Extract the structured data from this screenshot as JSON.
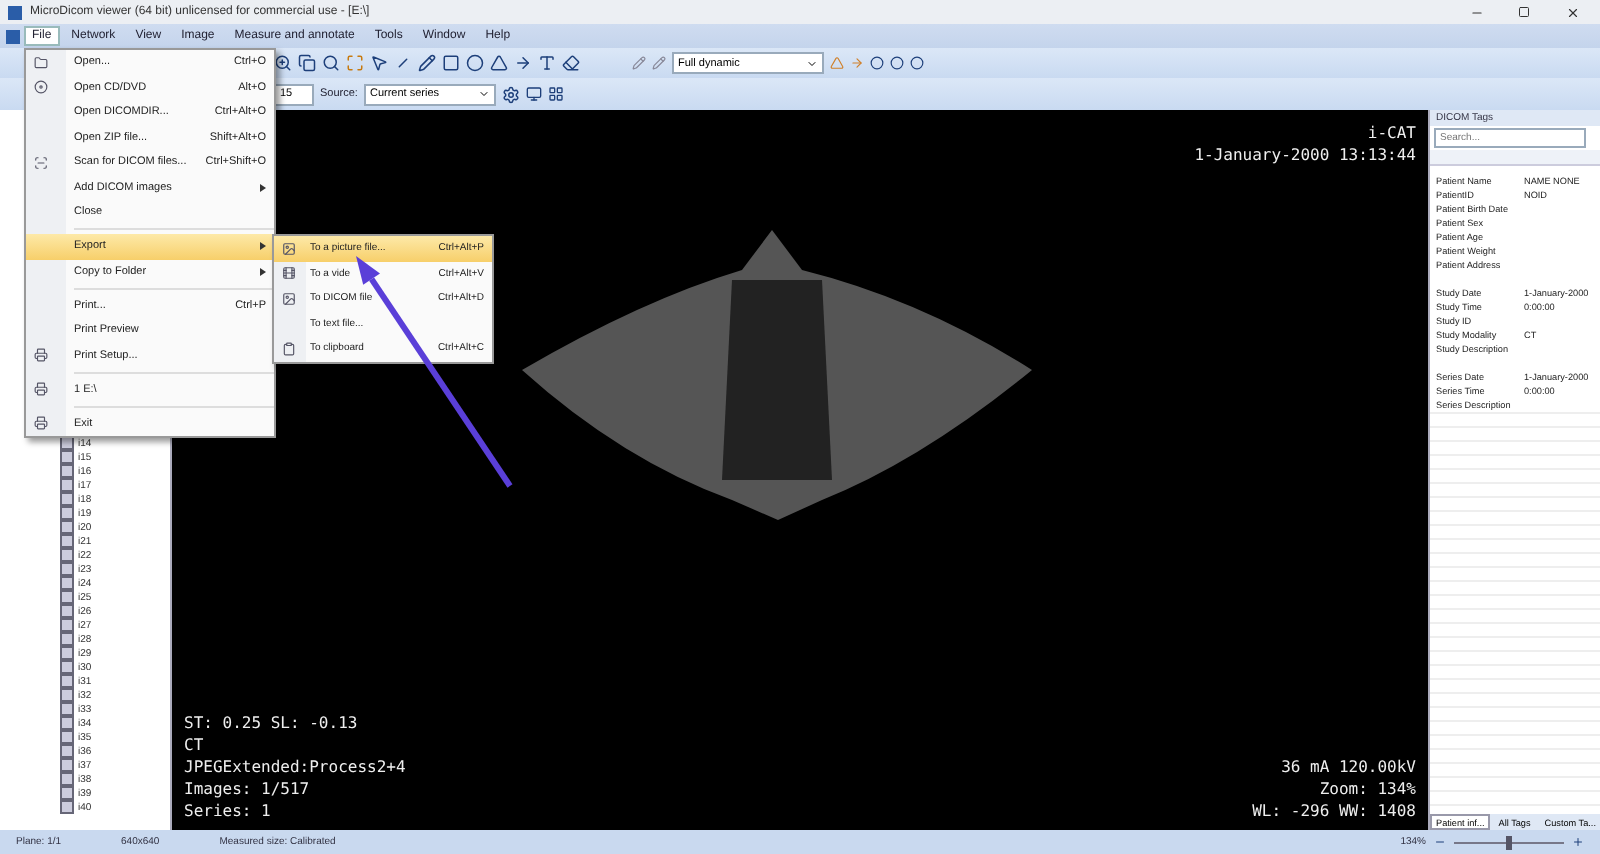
{
  "window": {
    "title": "MicroDicom viewer (64 bit) unlicensed for commercial use - [E:\\]"
  },
  "menu_bar": [
    {
      "label": "File",
      "selected": true
    },
    {
      "label": "Network",
      "selected": false
    },
    {
      "label": "View",
      "selected": false
    },
    {
      "label": "Image",
      "selected": false
    },
    {
      "label": "Measure and annotate",
      "selected": false
    },
    {
      "label": "Tools",
      "selected": false
    },
    {
      "label": "Window",
      "selected": false
    },
    {
      "label": "Help",
      "selected": false
    }
  ],
  "toolbar": {
    "display_mode": "Full dynamic",
    "frame_field": "15",
    "source_label": "Source:",
    "source": "Current series"
  },
  "file_menu": [
    {
      "kind": "item",
      "label": "Open...",
      "shortcut": "Ctrl+O",
      "selected": false
    },
    {
      "kind": "item",
      "label": "Open CD/DVD",
      "shortcut": "Alt+O",
      "selected": false
    },
    {
      "kind": "item",
      "label": "Open DICOMDIR...",
      "shortcut": "Ctrl+Alt+O",
      "selected": false
    },
    {
      "kind": "item",
      "label": "Open ZIP file...",
      "shortcut": "Shift+Alt+O",
      "selected": false
    },
    {
      "kind": "item",
      "label": "Scan for DICOM files...",
      "shortcut": "Ctrl+Shift+O",
      "selected": false
    },
    {
      "kind": "submenu",
      "label": "Add DICOM images",
      "selected": false
    },
    {
      "kind": "item",
      "label": "Close",
      "selected": false
    },
    {
      "kind": "separator"
    },
    {
      "kind": "submenu",
      "label": "Export",
      "selected": true
    },
    {
      "kind": "submenu",
      "label": "Copy to Folder",
      "selected": false
    },
    {
      "kind": "separator"
    },
    {
      "kind": "item",
      "label": "Print...",
      "shortcut": "Ctrl+P",
      "selected": false
    },
    {
      "kind": "item",
      "label": "Print Preview",
      "selected": false
    },
    {
      "kind": "item",
      "label": "Print Setup...",
      "selected": false
    },
    {
      "kind": "separator"
    },
    {
      "kind": "item",
      "label": "1 E:\\",
      "selected": false
    },
    {
      "kind": "separator"
    },
    {
      "kind": "item",
      "label": "Exit",
      "selected": false
    }
  ],
  "export_submenu": [
    {
      "label": "To a picture file...",
      "shortcut": "Ctrl+Alt+P",
      "selected": true
    },
    {
      "label": "To a vide",
      "shortcut": "Ctrl+Alt+V",
      "selected": false
    },
    {
      "label": "To DICOM file",
      "shortcut": "Ctrl+Alt+D",
      "selected": false
    },
    {
      "label": "To text file...",
      "selected": false
    },
    {
      "label": "To clipboard",
      "shortcut": "Ctrl+Alt+C",
      "selected": false
    }
  ],
  "image_tree": [
    "i14",
    "i15",
    "i16",
    "i17",
    "i18",
    "i19",
    "i20",
    "i21",
    "i22",
    "i23",
    "i24",
    "i25",
    "i26",
    "i27",
    "i28",
    "i29",
    "i30",
    "i31",
    "i32",
    "i33",
    "i34",
    "i35",
    "i36",
    "i37",
    "i38",
    "i39",
    "i40"
  ],
  "viewer": {
    "top_right": [
      "i-CAT",
      "1-January-2000 13:13:44"
    ],
    "bottom_left": [
      "ST: 0.25 SL: -0.13",
      "CT",
      "JPEGExtended:Process2+4",
      "Images: 1/517",
      "Series: 1"
    ],
    "bottom_right": [
      "36 mA 120.00kV",
      "Zoom: 134%",
      "WL: -296 WW: 1408"
    ]
  },
  "dicom_tags": {
    "title": "DICOM Tags",
    "search": {
      "placeholder": "Search..."
    },
    "groups": [
      [
        {
          "name": "Patient Name",
          "value": "NAME NONE"
        },
        {
          "name": "PatientID",
          "value": "NOID"
        },
        {
          "name": "Patient Birth Date"
        },
        {
          "name": "Patient Sex"
        },
        {
          "name": "Patient Age"
        },
        {
          "name": "Patient Weight"
        },
        {
          "name": "Patient Address"
        }
      ],
      [
        {
          "name": "Study Date",
          "value": "1-January-2000"
        },
        {
          "name": "Study Time",
          "value": "0:00:00"
        },
        {
          "name": "Study ID"
        },
        {
          "name": "Study Modality",
          "value": "CT"
        },
        {
          "name": "Study Description"
        }
      ],
      [
        {
          "name": "Series Date",
          "value": "1-January-2000"
        },
        {
          "name": "Series Time",
          "value": "0:00:00"
        },
        {
          "name": "Series Description"
        }
      ]
    ],
    "tabs": [
      {
        "label": "Patient inf...",
        "selected": true
      },
      {
        "label": "All Tags",
        "selected": false
      },
      {
        "label": "Custom Ta...",
        "selected": false
      }
    ]
  },
  "status_bar": {
    "plane": "Plane: 1/1",
    "size": "640x640",
    "measured": "Measured size: Calibrated",
    "zoom": "134%",
    "zoom_slider": {
      "level": 0.5
    }
  }
}
